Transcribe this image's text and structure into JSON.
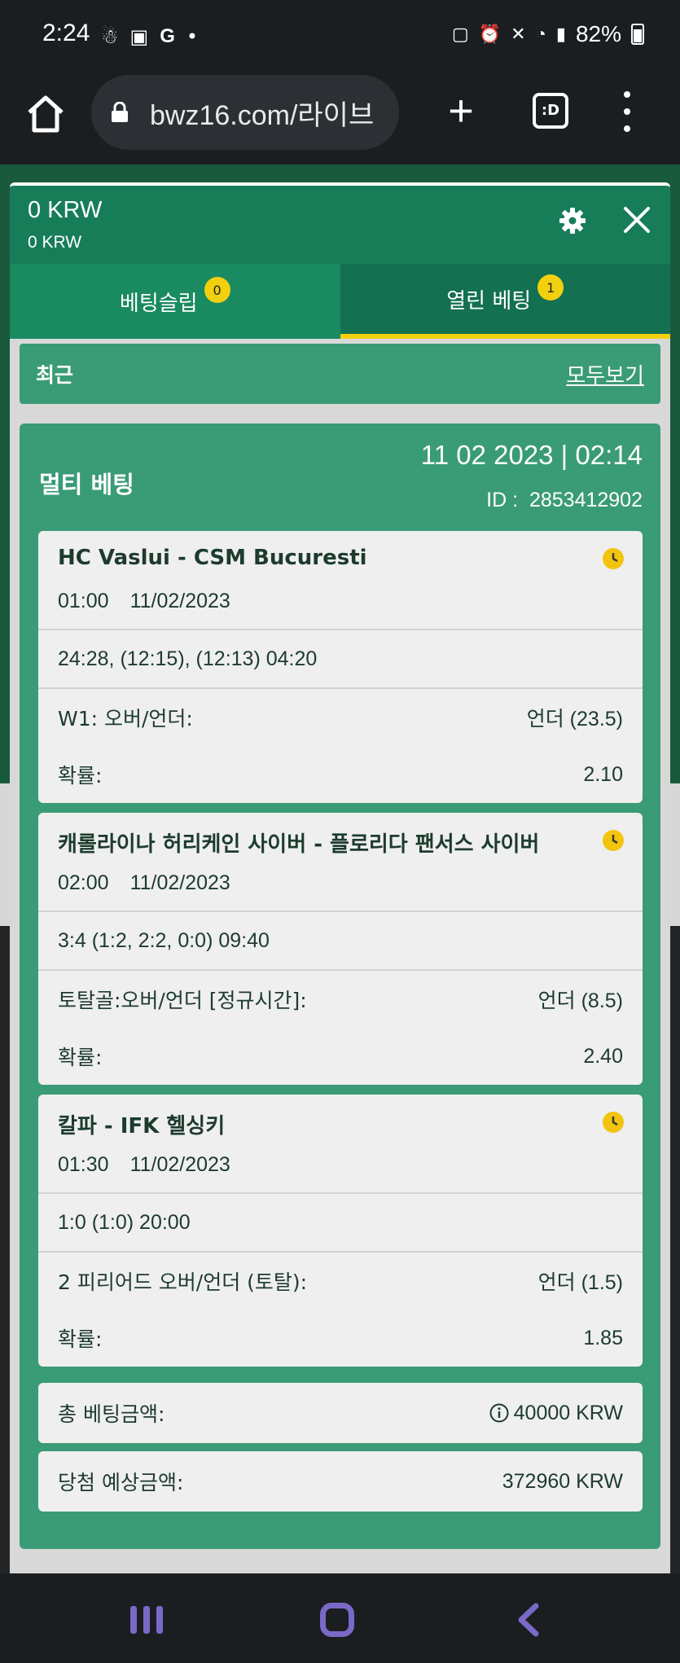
{
  "status_bar": {
    "time": "2:24",
    "battery": "82%"
  },
  "browser": {
    "url": "bwz16.com/라이브",
    "tabs_label": ":D"
  },
  "panel": {
    "balance": "0 KRW",
    "balance_secondary": "0 KRW",
    "tabs": [
      {
        "label": "베팅슬립",
        "badge": "0"
      },
      {
        "label": "열린 베팅",
        "badge": "1"
      }
    ],
    "recent_label": "최근",
    "view_all": "모두보기"
  },
  "bet": {
    "type": "멀티 베팅",
    "date": "11 02 2023 | 02:14",
    "id_label": "ID :",
    "id_value": "2853412902",
    "selections": [
      {
        "match": "HC Vaslui - CSM Bucuresti",
        "time": "01:00",
        "date": "11/02/2023",
        "score": "24:28, (12:15), (12:13) 04:20",
        "market": "W1: 오버/언더:",
        "pick": "언더 (23.5)",
        "odds_label": "확률:",
        "odds": "2.10"
      },
      {
        "match": "캐롤라이나 허리케인 사이버 - 플로리다 팬서스 사이버",
        "time": "02:00",
        "date": "11/02/2023",
        "score": "3:4 (1:2, 2:2, 0:0) 09:40",
        "market": "토탈골:오버/언더 [정규시간]:",
        "pick": "언더 (8.5)",
        "odds_label": "확률:",
        "odds": "2.40"
      },
      {
        "match": "칼파 - IFK 헬싱키",
        "time": "01:30",
        "date": "11/02/2023",
        "score": "1:0 (1:0) 20:00",
        "market": "2 피리어드 오버/언더 (토탈):",
        "pick": "언더 (1.5)",
        "odds_label": "확률:",
        "odds": "1.85"
      }
    ],
    "total_stake_label": "총 베팅금액:",
    "total_stake": "40000 KRW",
    "potential_win_label": "당첨 예상금액:",
    "potential_win": "372960 KRW"
  },
  "colors": {
    "header_green": "#177d58",
    "card_green": "#3a9b77",
    "accent_yellow": "#f2d00e",
    "nav_purple": "#7a69c7"
  },
  "icons": [
    "home-icon",
    "lock-icon",
    "plus-icon",
    "tabs-icon",
    "menu-icon",
    "gear-icon",
    "close-icon",
    "clock-icon",
    "info-icon",
    "nav-recent-icon",
    "nav-home-icon",
    "nav-back-icon"
  ]
}
